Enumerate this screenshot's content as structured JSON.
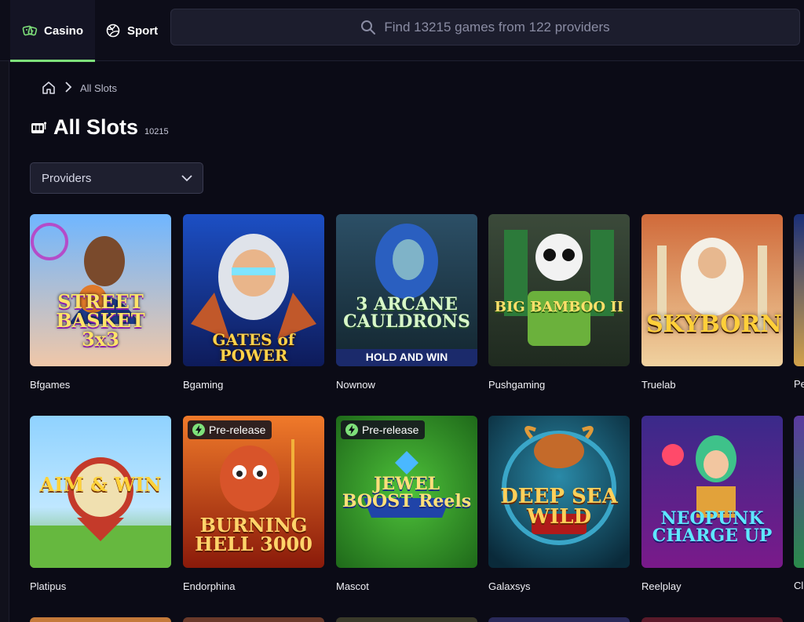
{
  "nav": {
    "casino_label": "Casino",
    "sport_label": "Sport"
  },
  "search": {
    "placeholder": "Find 13215 games from 122 providers"
  },
  "breadcrumb": {
    "current": "All Slots"
  },
  "page": {
    "title": "All Slots",
    "count": "10215"
  },
  "filters": {
    "providers_label": "Providers"
  },
  "games": [
    {
      "title": "STREET BASKET 3x3",
      "provider": "Bfgames",
      "badge": ""
    },
    {
      "title": "GATES of POWER",
      "provider": "Bgaming",
      "badge": ""
    },
    {
      "title": "3 ARCANE CAULDRONS",
      "subtitle": "HOLD AND WIN",
      "provider": "Nownow",
      "badge": ""
    },
    {
      "title": "BIG BAMBOO II",
      "provider": "Pushgaming",
      "badge": ""
    },
    {
      "title": "SKYBORN",
      "provider": "Truelab",
      "badge": ""
    },
    {
      "title": "AIM & WIN",
      "provider": "Platipus",
      "badge": ""
    },
    {
      "title": "BURNING HELL 3000",
      "provider": "Endorphina",
      "badge": "Pre-release"
    },
    {
      "title": "JEWEL BOOST Reels",
      "provider": "Mascot",
      "badge": "Pre-release"
    },
    {
      "title": "DEEP SEA WILD",
      "provider": "Galaxsys",
      "badge": ""
    },
    {
      "title": "NEOPUNK CHARGE UP",
      "provider": "Reelplay",
      "badge": ""
    }
  ],
  "partial_labels": [
    "Pe",
    "Cl"
  ],
  "colors": {
    "background": "#0b0b16",
    "accent": "#7ee07a",
    "search_bg": "#1c1d2d"
  }
}
